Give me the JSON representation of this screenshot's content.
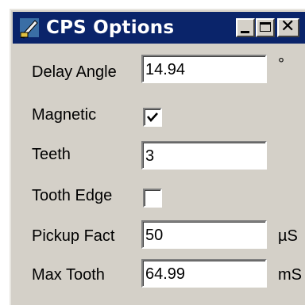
{
  "window": {
    "title": "CPS Options",
    "icon": "pencil-ruler-icon",
    "title_bar_color": "#0a246a",
    "face_color": "#d4d0c8"
  },
  "title_buttons": {
    "minimize": "minimize-icon",
    "maximize": "maximize-icon",
    "close": "✕"
  },
  "fields": {
    "delay_angle": {
      "label": "Delay Angle",
      "value": "14.94",
      "unit": "°"
    },
    "magnetic": {
      "label": "Magnetic",
      "checked": true
    },
    "teeth": {
      "label": "Teeth",
      "value": "3"
    },
    "tooth_edge": {
      "label": "Tooth Edge",
      "checked": false
    },
    "pickup_fact": {
      "label": "Pickup Fact",
      "value": "50",
      "unit": "µS"
    },
    "max_tooth": {
      "label": "Max Tooth",
      "value": "64.99",
      "unit": "mS"
    }
  }
}
